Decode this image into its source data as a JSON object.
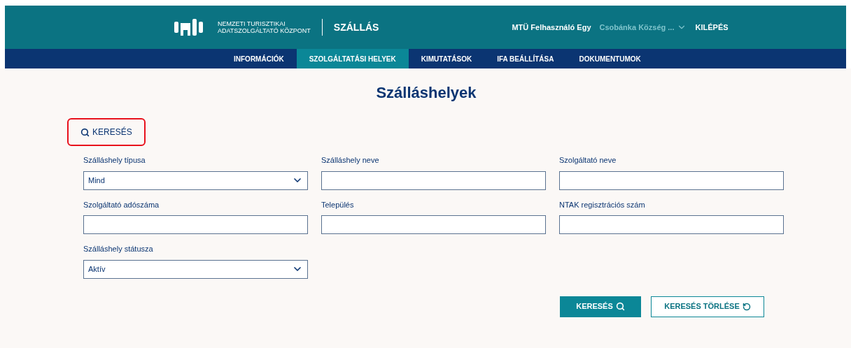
{
  "header": {
    "logo_text": "NEMZETI TURISZTIKAI\nADATSZOLGÁLTATÓ KÖZPONT",
    "app_title": "SZÁLLÁS",
    "user": "MTÜ Felhasználó Egy",
    "organization": "Csobánka Község ...",
    "logout": "KILÉPÉS"
  },
  "nav": [
    {
      "label": "INFORMÁCIÓK",
      "selected": false
    },
    {
      "label": "SZOLGÁLTATÁSI HELYEK",
      "selected": true
    },
    {
      "label": "KIMUTATÁSOK",
      "selected": false
    },
    {
      "label": "IFA BEÁLLÍTÁSA",
      "selected": false
    },
    {
      "label": "DOKUMENTUMOK",
      "selected": false
    }
  ],
  "page_title": "Szálláshelyek",
  "search_toggle": {
    "label": "KERESÉS",
    "highlighted": true
  },
  "fields": [
    {
      "kind": "select",
      "label": "Szálláshely típusa",
      "value": "Mind"
    },
    {
      "kind": "text",
      "label": "Szálláshely neve"
    },
    {
      "kind": "text",
      "label": "Szolgáltató neve"
    },
    {
      "kind": "text",
      "label": "Szolgáltató adószáma"
    },
    {
      "kind": "text",
      "label": "Település"
    },
    {
      "kind": "text",
      "label": "NTAK regisztrációs szám"
    },
    {
      "kind": "select",
      "label": "Szálláshely státusza",
      "value": "Aktív"
    }
  ],
  "buttons": [
    {
      "kind": "primary",
      "label": "KERESÉS"
    },
    {
      "kind": "secondary",
      "label": "KERESÉS TÖRLÉSE"
    }
  ]
}
